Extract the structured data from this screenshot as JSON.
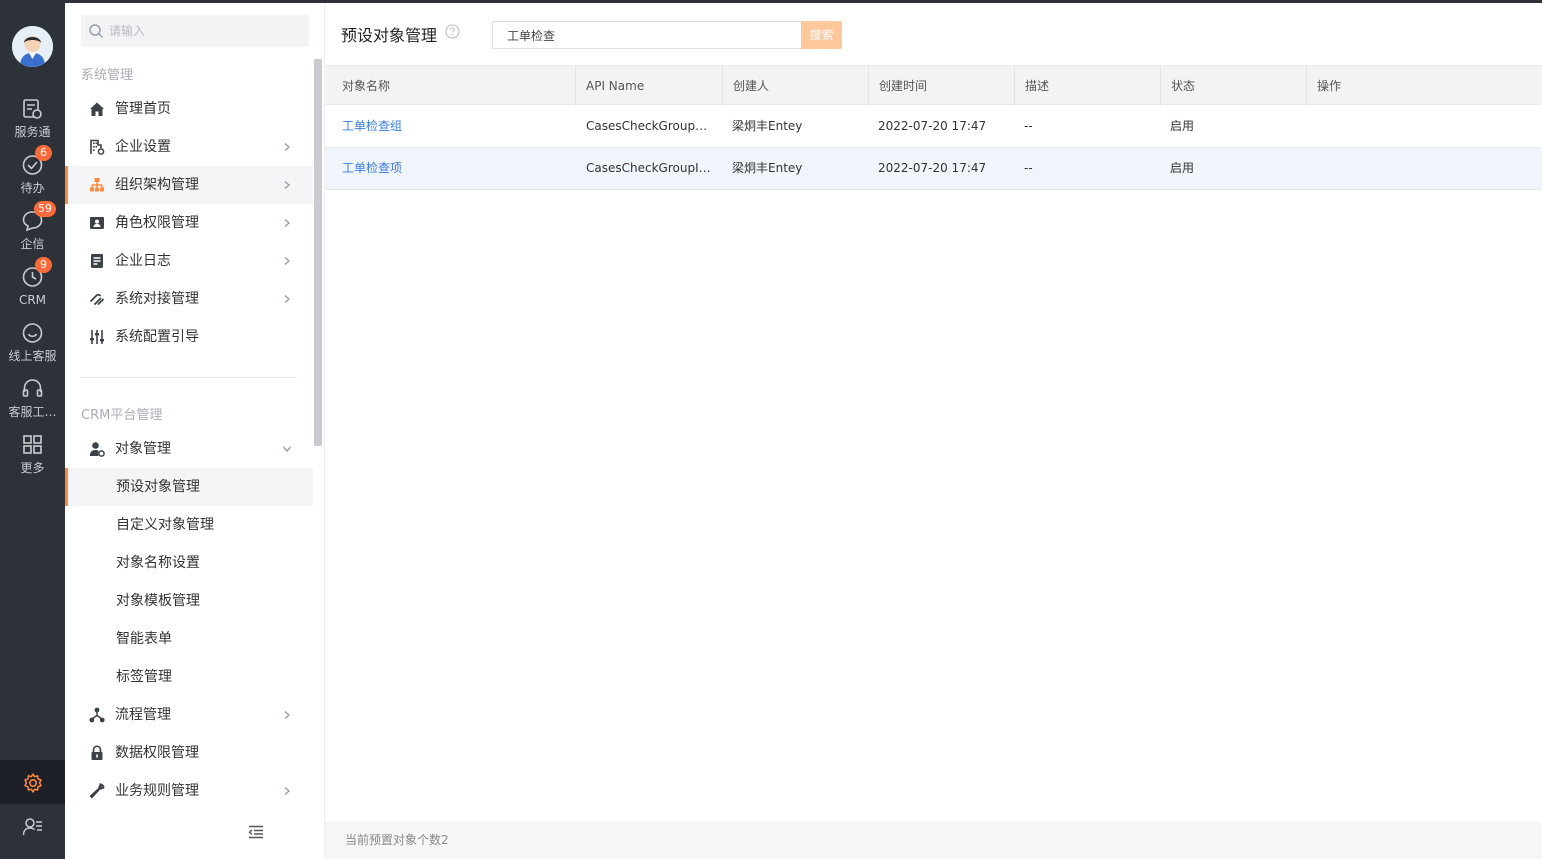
{
  "rail": {
    "items": [
      {
        "label": "服务通",
        "badge": ""
      },
      {
        "label": "待办",
        "badge": "6"
      },
      {
        "label": "企信",
        "badge": "59"
      },
      {
        "label": "CRM",
        "badge": "9"
      },
      {
        "label": "线上客服",
        "badge": ""
      },
      {
        "label": "客服工…",
        "badge": ""
      },
      {
        "label": "更多",
        "badge": ""
      }
    ],
    "accent": "#ff8a3d"
  },
  "sidebar": {
    "search_placeholder": "请输入",
    "section1_title": "系统管理",
    "section1_items": [
      {
        "label": "管理首页",
        "icon": "home-icon"
      },
      {
        "label": "企业设置",
        "icon": "building-icon"
      },
      {
        "label": "组织架构管理",
        "icon": "org-chart-icon"
      },
      {
        "label": "角色权限管理",
        "icon": "id-card-icon"
      },
      {
        "label": "企业日志",
        "icon": "document-icon"
      },
      {
        "label": "系统对接管理",
        "icon": "link-icon"
      },
      {
        "label": "系统配置引导",
        "icon": "sliders-icon"
      }
    ],
    "section2_title": "CRM平台管理",
    "object_mgmt_label": "对象管理",
    "object_sub_items": [
      "预设对象管理",
      "自定义对象管理",
      "对象名称设置",
      "对象模板管理",
      "智能表单",
      "标签管理"
    ],
    "section2_items": [
      {
        "label": "流程管理",
        "icon": "flow-icon"
      },
      {
        "label": "数据权限管理",
        "icon": "lock-icon"
      },
      {
        "label": "业务规则管理",
        "icon": "wrench-icon"
      }
    ]
  },
  "main": {
    "title": "预设对象管理",
    "search_value": "工单检查",
    "search_button": "搜索",
    "columns": [
      "对象名称",
      "API Name",
      "创建人",
      "创建时间",
      "描述",
      "状态",
      "操作"
    ],
    "rows": [
      [
        "工单检查组",
        "CasesCheckGroupObj",
        "梁炯丰Entey",
        "2022-07-20 17:47",
        "--",
        "启用",
        ""
      ],
      [
        "工单检查项",
        "CasesCheckGroupItemObj",
        "梁炯丰Entey",
        "2022-07-20 17:47",
        "--",
        "启用",
        ""
      ]
    ],
    "footer_text": "当前预置对象个数2"
  }
}
